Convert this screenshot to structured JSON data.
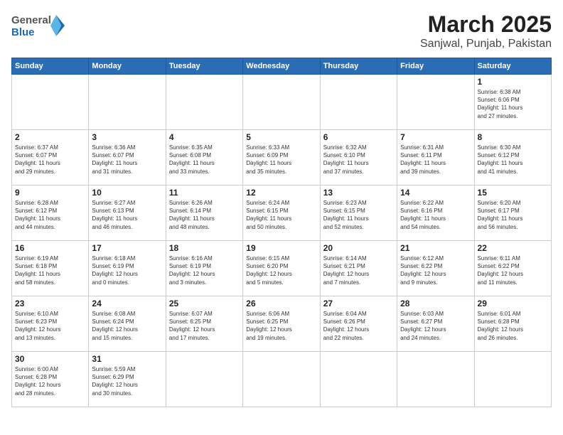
{
  "header": {
    "logo_general": "General",
    "logo_blue": "Blue",
    "title": "March 2025",
    "subtitle": "Sanjwal, Punjab, Pakistan"
  },
  "weekdays": [
    "Sunday",
    "Monday",
    "Tuesday",
    "Wednesday",
    "Thursday",
    "Friday",
    "Saturday"
  ],
  "weeks": [
    [
      {
        "day": "",
        "info": ""
      },
      {
        "day": "",
        "info": ""
      },
      {
        "day": "",
        "info": ""
      },
      {
        "day": "",
        "info": ""
      },
      {
        "day": "",
        "info": ""
      },
      {
        "day": "",
        "info": ""
      },
      {
        "day": "1",
        "info": "Sunrise: 6:38 AM\nSunset: 6:06 PM\nDaylight: 11 hours\nand 27 minutes."
      }
    ],
    [
      {
        "day": "2",
        "info": "Sunrise: 6:37 AM\nSunset: 6:07 PM\nDaylight: 11 hours\nand 29 minutes."
      },
      {
        "day": "3",
        "info": "Sunrise: 6:36 AM\nSunset: 6:07 PM\nDaylight: 11 hours\nand 31 minutes."
      },
      {
        "day": "4",
        "info": "Sunrise: 6:35 AM\nSunset: 6:08 PM\nDaylight: 11 hours\nand 33 minutes."
      },
      {
        "day": "5",
        "info": "Sunrise: 6:33 AM\nSunset: 6:09 PM\nDaylight: 11 hours\nand 35 minutes."
      },
      {
        "day": "6",
        "info": "Sunrise: 6:32 AM\nSunset: 6:10 PM\nDaylight: 11 hours\nand 37 minutes."
      },
      {
        "day": "7",
        "info": "Sunrise: 6:31 AM\nSunset: 6:11 PM\nDaylight: 11 hours\nand 39 minutes."
      },
      {
        "day": "8",
        "info": "Sunrise: 6:30 AM\nSunset: 6:12 PM\nDaylight: 11 hours\nand 41 minutes."
      }
    ],
    [
      {
        "day": "9",
        "info": "Sunrise: 6:28 AM\nSunset: 6:12 PM\nDaylight: 11 hours\nand 44 minutes."
      },
      {
        "day": "10",
        "info": "Sunrise: 6:27 AM\nSunset: 6:13 PM\nDaylight: 11 hours\nand 46 minutes."
      },
      {
        "day": "11",
        "info": "Sunrise: 6:26 AM\nSunset: 6:14 PM\nDaylight: 11 hours\nand 48 minutes."
      },
      {
        "day": "12",
        "info": "Sunrise: 6:24 AM\nSunset: 6:15 PM\nDaylight: 11 hours\nand 50 minutes."
      },
      {
        "day": "13",
        "info": "Sunrise: 6:23 AM\nSunset: 6:15 PM\nDaylight: 11 hours\nand 52 minutes."
      },
      {
        "day": "14",
        "info": "Sunrise: 6:22 AM\nSunset: 6:16 PM\nDaylight: 11 hours\nand 54 minutes."
      },
      {
        "day": "15",
        "info": "Sunrise: 6:20 AM\nSunset: 6:17 PM\nDaylight: 11 hours\nand 56 minutes."
      }
    ],
    [
      {
        "day": "16",
        "info": "Sunrise: 6:19 AM\nSunset: 6:18 PM\nDaylight: 11 hours\nand 58 minutes."
      },
      {
        "day": "17",
        "info": "Sunrise: 6:18 AM\nSunset: 6:19 PM\nDaylight: 12 hours\nand 0 minutes."
      },
      {
        "day": "18",
        "info": "Sunrise: 6:16 AM\nSunset: 6:19 PM\nDaylight: 12 hours\nand 3 minutes."
      },
      {
        "day": "19",
        "info": "Sunrise: 6:15 AM\nSunset: 6:20 PM\nDaylight: 12 hours\nand 5 minutes."
      },
      {
        "day": "20",
        "info": "Sunrise: 6:14 AM\nSunset: 6:21 PM\nDaylight: 12 hours\nand 7 minutes."
      },
      {
        "day": "21",
        "info": "Sunrise: 6:12 AM\nSunset: 6:22 PM\nDaylight: 12 hours\nand 9 minutes."
      },
      {
        "day": "22",
        "info": "Sunrise: 6:11 AM\nSunset: 6:22 PM\nDaylight: 12 hours\nand 11 minutes."
      }
    ],
    [
      {
        "day": "23",
        "info": "Sunrise: 6:10 AM\nSunset: 6:23 PM\nDaylight: 12 hours\nand 13 minutes."
      },
      {
        "day": "24",
        "info": "Sunrise: 6:08 AM\nSunset: 6:24 PM\nDaylight: 12 hours\nand 15 minutes."
      },
      {
        "day": "25",
        "info": "Sunrise: 6:07 AM\nSunset: 6:25 PM\nDaylight: 12 hours\nand 17 minutes."
      },
      {
        "day": "26",
        "info": "Sunrise: 6:06 AM\nSunset: 6:25 PM\nDaylight: 12 hours\nand 19 minutes."
      },
      {
        "day": "27",
        "info": "Sunrise: 6:04 AM\nSunset: 6:26 PM\nDaylight: 12 hours\nand 22 minutes."
      },
      {
        "day": "28",
        "info": "Sunrise: 6:03 AM\nSunset: 6:27 PM\nDaylight: 12 hours\nand 24 minutes."
      },
      {
        "day": "29",
        "info": "Sunrise: 6:01 AM\nSunset: 6:28 PM\nDaylight: 12 hours\nand 26 minutes."
      }
    ],
    [
      {
        "day": "30",
        "info": "Sunrise: 6:00 AM\nSunset: 6:28 PM\nDaylight: 12 hours\nand 28 minutes."
      },
      {
        "day": "31",
        "info": "Sunrise: 5:59 AM\nSunset: 6:29 PM\nDaylight: 12 hours\nand 30 minutes."
      },
      {
        "day": "",
        "info": ""
      },
      {
        "day": "",
        "info": ""
      },
      {
        "day": "",
        "info": ""
      },
      {
        "day": "",
        "info": ""
      },
      {
        "day": "",
        "info": ""
      }
    ]
  ]
}
